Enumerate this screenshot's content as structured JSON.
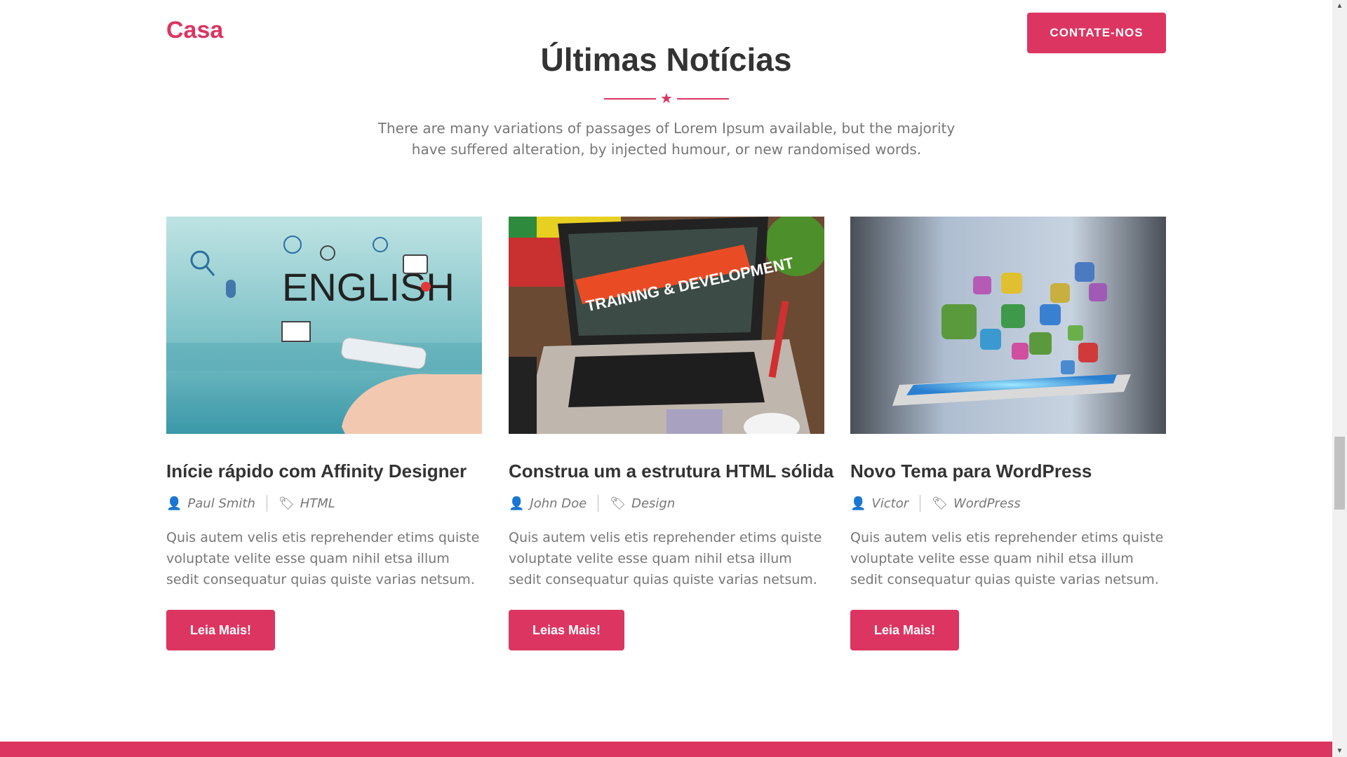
{
  "header": {
    "brand": "Casa",
    "contact_label": "CONTATE-NOS"
  },
  "section": {
    "title": "Últimas Notícias",
    "description": "There are many variations of passages of Lorem Ipsum available, but the majority have suffered alteration, by injected humour, or new randomised words."
  },
  "cards": [
    {
      "title": "Inície rápido com Affinity Designer",
      "author": "Paul Smith",
      "tag": "HTML",
      "text": "Quis autem velis etis reprehender etims quiste voluptate velite esse quam nihil etsa illum sedit consequatur quias quiste varias netsum.",
      "button": "Leia Mais!",
      "image_text": "ENGLISH"
    },
    {
      "title": "Construa um a estrutura HTML sólida",
      "author": "John Doe",
      "tag": "Design",
      "text": "Quis autem velis etis reprehender etims quiste voluptate velite esse quam nihil etsa illum sedit consequatur quias quiste varias netsum.",
      "button": "Leias Mais!",
      "image_text": "TRAINING & DEVELOPMENT"
    },
    {
      "title": "Novo Tema para WordPress",
      "author": "Victor",
      "tag": "WordPress",
      "text": "Quis autem velis etis reprehender etims quiste voluptate velite esse quam nihil etsa illum sedit consequatur quias quiste varias netsum.",
      "button": "Leia Mais!"
    }
  ],
  "colors": {
    "accent": "#dc3561",
    "text": "#333333",
    "muted": "#777777"
  },
  "icons": {
    "author": "user-icon",
    "tag": "tags-icon",
    "divider": "star-icon"
  }
}
